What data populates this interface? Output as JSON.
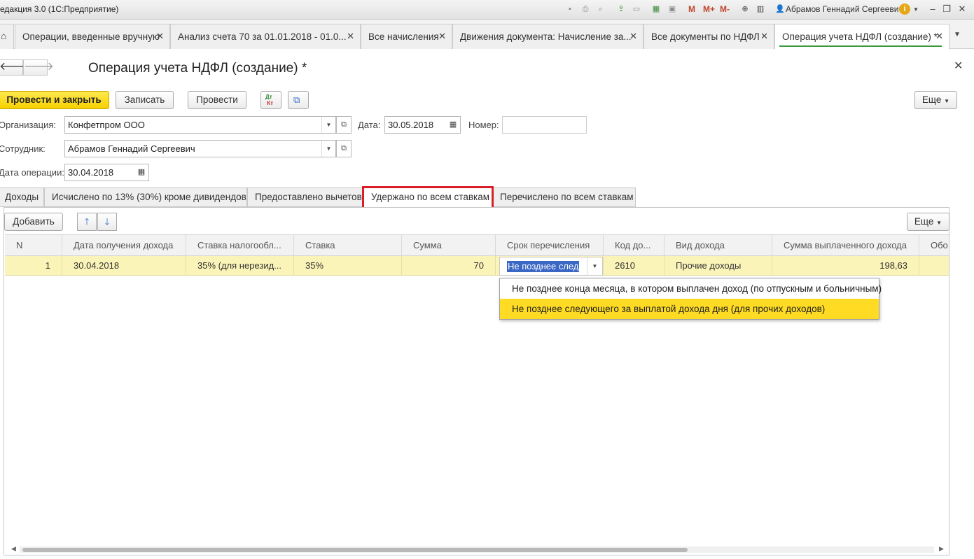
{
  "window": {
    "app_title": "едакция 3.0  (1С:Предприятие)",
    "user": "Абрамов Геннадий Сергеевич",
    "toolbar_icons": [
      "save-icon",
      "print-icon",
      "preview-icon",
      "upload-icon",
      "clipboard-icon",
      "calculator-icon",
      "calendar-icon",
      "m-icon",
      "m-plus-icon",
      "m-minus-icon",
      "zoom-icon",
      "panel-icon"
    ],
    "memory_labels": [
      "M",
      "M+",
      "M-"
    ]
  },
  "tabs": [
    {
      "label": "Операции, введенные вручную"
    },
    {
      "label": "Анализ счета 70 за 01.01.2018 - 01.0..."
    },
    {
      "label": "Все начисления"
    },
    {
      "label": "Движения документа: Начисление за..."
    },
    {
      "label": "Все документы по НДФЛ"
    },
    {
      "label": "Операция учета НДФЛ (создание) *",
      "active": true
    }
  ],
  "form": {
    "title": "Операция учета НДФЛ (создание) *",
    "buttons": {
      "post_close": "Провести и закрыть",
      "save": "Записать",
      "post": "Провести",
      "more": "Еще"
    },
    "fields": {
      "org_label": "Организация:",
      "org_value": "Конфетпром ООО",
      "date_label": "Дата:",
      "date_value": "30.05.2018",
      "number_label": "Номер:",
      "number_value": "",
      "employee_label": "Сотрудник:",
      "employee_value": "Абрамов Геннадий Сергеевич",
      "op_date_label": "Дата операции:",
      "op_date_value": "30.04.2018"
    }
  },
  "inner_tabs": [
    {
      "label": "Доходы"
    },
    {
      "label": "Исчислено по 13% (30%) кроме дивидендов"
    },
    {
      "label": "Предоставлено вычетов"
    },
    {
      "label": "Удержано по всем ставкам",
      "active": true
    },
    {
      "label": "Перечислено по всем ставкам"
    }
  ],
  "table": {
    "add_button": "Добавить",
    "more_button": "Еще",
    "columns": [
      "N",
      "Дата получения дохода",
      "Ставка налогообл...",
      "Ставка",
      "Сумма",
      "Срок перечисления",
      "Код до...",
      "Вид дохода",
      "Сумма выплаченного дохода",
      "Обо"
    ],
    "rows": [
      {
        "n": "1",
        "income_date": "30.04.2018",
        "tax_rate": "35% (для нерезид...",
        "rate": "35%",
        "amount": "70",
        "deadline": "Не позднее след",
        "code": "2610",
        "income_type": "Прочие доходы",
        "paid_amount": "198,63",
        "extra": ""
      }
    ],
    "dropdown_options": [
      {
        "label": "Не позднее конца месяца, в котором выплачен доход (по отпускным и больничным)",
        "selected": false
      },
      {
        "label": "Не позднее следующего за выплатой дохода дня (для прочих доходов)",
        "selected": true
      }
    ]
  },
  "colors": {
    "primary_button": "#f7d100",
    "row_highlight": "#fbf4b8",
    "selected_option": "#ffdc23",
    "tab_marker": "#d9202a"
  }
}
